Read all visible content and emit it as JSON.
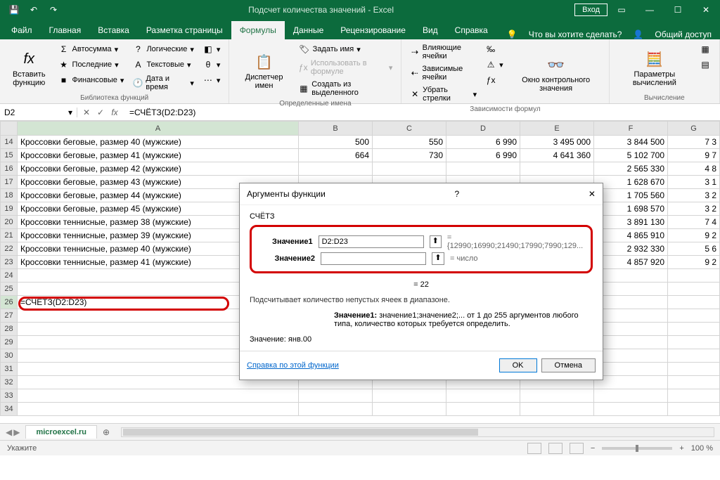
{
  "app": {
    "title": "Подсчет количества значений  -  Excel",
    "login": "Вход"
  },
  "tabs": [
    "Файл",
    "Главная",
    "Вставка",
    "Разметка страницы",
    "Формулы",
    "Данные",
    "Рецензирование",
    "Вид",
    "Справка"
  ],
  "search_hint": "Что вы хотите сделать?",
  "share": "Общий доступ",
  "ribbon": {
    "insert_fn": "Вставить функцию",
    "autosum": "Автосумма",
    "recent": "Последние",
    "financial": "Финансовые",
    "logical": "Логические",
    "text": "Текстовые",
    "datetime": "Дата и время",
    "lookup": "",
    "g1": "Библиотека функций",
    "name_mgr": "Диспетчер имен",
    "define": "Задать имя",
    "use_in_formula": "Использовать в формуле",
    "from_selection": "Создать из выделенного",
    "g2": "Определенные имена",
    "trace_prec": "Влияющие ячейки",
    "trace_dep": "Зависимые ячейки",
    "remove_arrows": "Убрать стрелки",
    "watch": "Окно контрольного значения",
    "g3": "Зависимости формул",
    "calc_opts": "Параметры вычислений",
    "g4": "Вычисление"
  },
  "name_box": "D2",
  "formula": "=СЧЁТЗ(D2:D23)",
  "columns": [
    "A",
    "B",
    "C",
    "D",
    "E",
    "F",
    "G"
  ],
  "rows": [
    {
      "n": 14,
      "a": "Кроссовки беговые, размер 40 (мужские)",
      "b": "500",
      "c": "550",
      "d": "6 990",
      "e": "3 495 000",
      "f": "3 844 500",
      "g": "7 3"
    },
    {
      "n": 15,
      "a": "Кроссовки беговые, размер 41 (мужские)",
      "b": "664",
      "c": "730",
      "d": "6 990",
      "e": "4 641 360",
      "f": "5 102 700",
      "g": "9 7"
    },
    {
      "n": 16,
      "a": "Кроссовки беговые, размер 42 (мужские)",
      "f": "2 565 330",
      "g": "4 8"
    },
    {
      "n": 17,
      "a": "Кроссовки беговые, размер 43 (мужские)",
      "f": "1 628 670",
      "g": "3 1"
    },
    {
      "n": 18,
      "a": "Кроссовки беговые, размер 44 (мужские)",
      "f": "1 705 560",
      "g": "3 2"
    },
    {
      "n": 19,
      "a": "Кроссовки беговые, размер 45 (мужские)",
      "f": "1 698 570",
      "g": "3 2"
    },
    {
      "n": 20,
      "a": "Кроссовки теннисные, размер 38 (мужские)",
      "f": "3 891 130",
      "g": "7 4"
    },
    {
      "n": 21,
      "a": "Кроссовки теннисные, размер 39 (мужские)",
      "f": "4 865 910",
      "g": "9 2"
    },
    {
      "n": 22,
      "a": "Кроссовки теннисные, размер 40 (мужские)",
      "f": "2 932 330",
      "g": "5 6"
    },
    {
      "n": 23,
      "a": "Кроссовки теннисные, размер 41 (мужские)",
      "f": "4 857 920",
      "g": "9 2"
    },
    {
      "n": 24
    },
    {
      "n": 25
    },
    {
      "n": 26,
      "a": "=СЧЁТЗ(D2:D23)"
    },
    {
      "n": 27
    },
    {
      "n": 28
    },
    {
      "n": 29
    },
    {
      "n": 30
    },
    {
      "n": 31
    },
    {
      "n": 32
    },
    {
      "n": 33
    },
    {
      "n": 34
    }
  ],
  "sheet": "microexcel.ru",
  "status": "Укажите",
  "zoom": "100 %",
  "dialog": {
    "title": "Аргументы функции",
    "fn": "СЧЁТЗ",
    "arg1_label": "Значение1",
    "arg1_value": "D2:D23",
    "arg1_result": "= {12990;16990;21490;17990;7990;129...",
    "arg2_label": "Значение2",
    "arg2_result": "= число",
    "result": "= 22",
    "desc": "Подсчитывает количество непустых ячеек в диапазоне.",
    "hint_label": "Значение1:",
    "hint_text": "значение1;значение2;... от 1 до 255 аргументов любого типа, количество которых требуется определить.",
    "value_label": "Значение:",
    "value": "янв.00",
    "help": "Справка по этой функции",
    "ok": "OK",
    "cancel": "Отмена"
  }
}
